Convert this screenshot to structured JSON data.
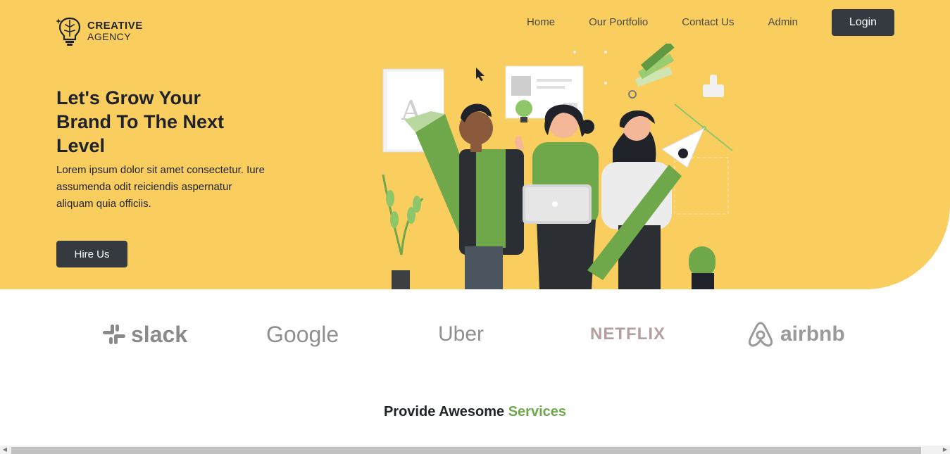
{
  "brand": {
    "line1": "CREATIVE",
    "line2": "AGENCY",
    "icon": "brain-bulb-icon"
  },
  "nav": {
    "items": [
      "Home",
      "Our Portfolio",
      "Contact Us",
      "Admin"
    ],
    "login_label": "Login"
  },
  "hero": {
    "headline": "Let's Grow Your Brand To The Next Level",
    "description": "Lorem ipsum dolor sit amet consectetur. Iure assumenda odit reiciendis aspernatur aliquam quia officiis.",
    "cta_label": "Hire Us",
    "illustration": "team-creative-illustration"
  },
  "partners": [
    "slack",
    "Google",
    "Uber",
    "NETFLIX",
    "airbnb"
  ],
  "services": {
    "title_prefix": "Provide Awesome ",
    "title_highlight": "Services"
  },
  "colors": {
    "hero_bg": "#f9cd5e",
    "dark": "#343a40",
    "accent_green": "#6ea84b"
  }
}
